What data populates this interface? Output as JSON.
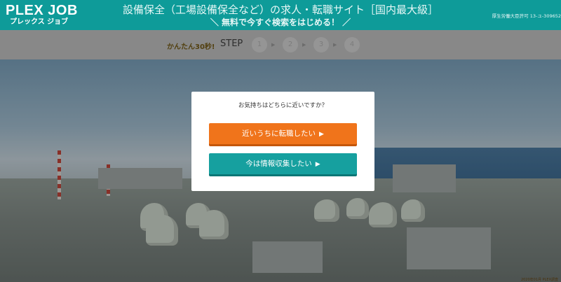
{
  "header": {
    "logo_main": "PLEX JOB",
    "logo_sub": "プレックス ジョブ",
    "title": "設備保全（工場設備保全など）の求人・転職サイト［国内最大級］",
    "subtitle": "＼ 無料で今すぐ検索をはじめる！ ／",
    "license": "厚生労働大臣許可 13-ユ-309652",
    "background_color": "#0e9b99"
  },
  "stepbar": {
    "quick_label": "かんたん30秒!",
    "step_label": "STEP",
    "steps": [
      "1",
      "2",
      "3",
      "4"
    ],
    "arrow": "▶"
  },
  "hero": {
    "footnote": "2020年01月 PLEX調査"
  },
  "modal": {
    "question": "お気持ちはどちらに近いですか？",
    "option_soon": "近いうちに転職したい",
    "option_info": "今は情報収集したい",
    "arrow": "▶",
    "colors": {
      "orange": "#f0741b",
      "teal": "#16a09f"
    }
  }
}
